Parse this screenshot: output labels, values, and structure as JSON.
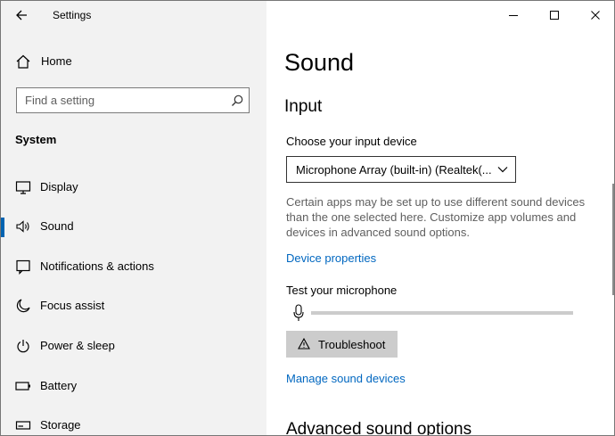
{
  "window": {
    "title": "Settings"
  },
  "sidebar": {
    "home_label": "Home",
    "search": {
      "placeholder": "Find a setting",
      "value": ""
    },
    "section_heading": "System",
    "items": [
      {
        "label": "Display",
        "icon": "display-icon",
        "selected": false
      },
      {
        "label": "Sound",
        "icon": "speaker-icon",
        "selected": true
      },
      {
        "label": "Notifications & actions",
        "icon": "notifications-icon",
        "selected": false
      },
      {
        "label": "Focus assist",
        "icon": "moon-icon",
        "selected": false
      },
      {
        "label": "Power & sleep",
        "icon": "power-icon",
        "selected": false
      },
      {
        "label": "Battery",
        "icon": "battery-icon",
        "selected": false
      },
      {
        "label": "Storage",
        "icon": "storage-icon",
        "selected": false
      }
    ]
  },
  "caption_buttons": [
    "minimize-icon",
    "maximize-icon",
    "close-icon"
  ],
  "main": {
    "page_title": "Sound",
    "input": {
      "heading": "Input",
      "device_label": "Choose your input device",
      "device_selected": "Microphone Array (built-in) (Realtek(...",
      "description": "Certain apps may be set up to use different sound devices than the one selected here. Customize app volumes and devices in advanced sound options.",
      "device_properties_link": "Device properties",
      "test_label": "Test your microphone",
      "mic_level": 0,
      "troubleshoot_label": "Troubleshoot",
      "manage_devices_link": "Manage sound devices"
    },
    "advanced_heading": "Advanced sound options"
  },
  "colors": {
    "accent": "#0067c0",
    "selection_bar": "#0063b1",
    "sidebar_bg": "#f2f2f2",
    "button_bg": "#cccccc"
  }
}
